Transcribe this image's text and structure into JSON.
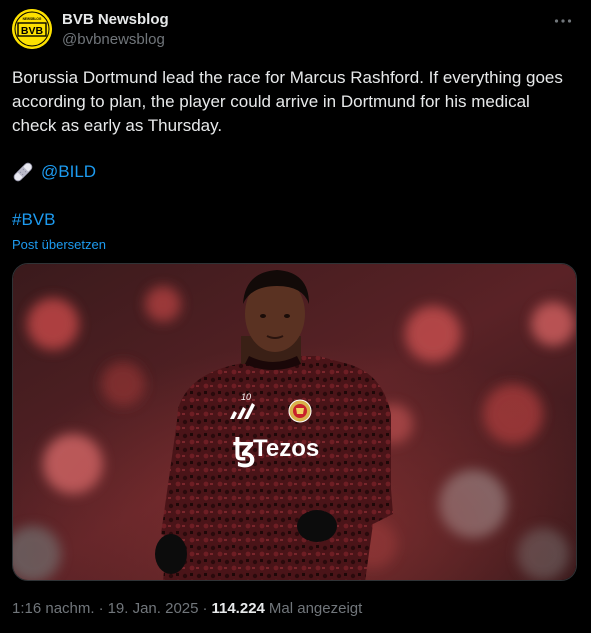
{
  "tweet": {
    "author_name": "BVB Newsblog",
    "author_handle": "@bvbnewsblog",
    "avatar_text": "BVB",
    "avatar_small_text": "NEWSBLOG",
    "text": "Borussia Dortmund lead the race for Marcus Rashford. If everything goes according to plan, the player could arrive in Dortmund for his medical check as early as Thursday.",
    "mention_icon": "adhesive-bandage-icon",
    "mention": "@BILD",
    "hashtag": "#BVB",
    "translate_label": "Post übersetzen",
    "time": "1:16 nachm.",
    "separator": "·",
    "date": "19. Jan. 2025",
    "views_count": "114.224",
    "views_label": "Mal angezeigt"
  },
  "photo": {
    "jersey_sponsor": "Tezos",
    "jersey_number": "10",
    "icons": [
      "adidas-logo-icon",
      "club-crest-icon",
      "tezos-logo-icon"
    ]
  },
  "colors": {
    "background": "#000000",
    "text": "#e7e9ea",
    "secondary": "#71767b",
    "link": "#1d9bf0",
    "border": "#2f3336",
    "brand_yellow": "#fde100"
  }
}
